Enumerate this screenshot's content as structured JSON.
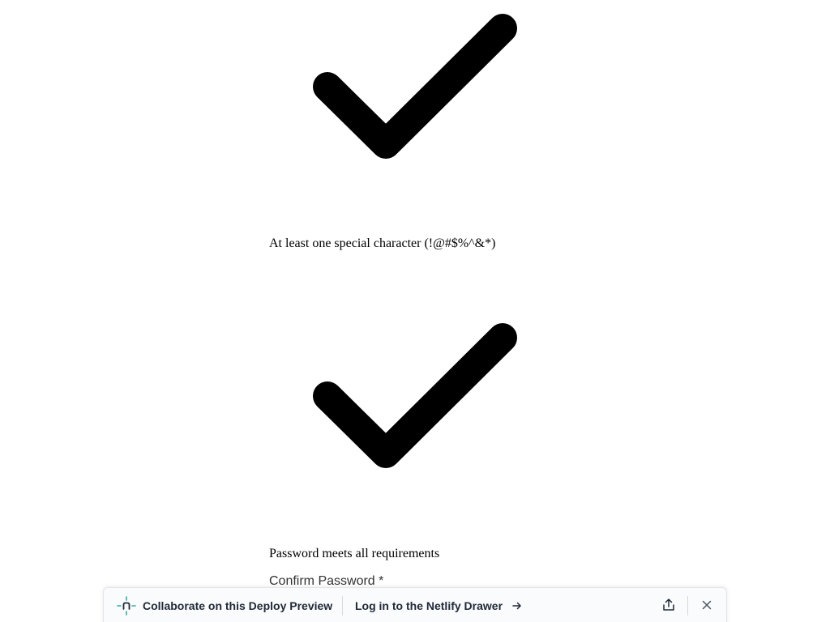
{
  "requirements": [
    {
      "icon": "checkmark-icon",
      "label": "At least one special character (!@#$%^&*)"
    },
    {
      "icon": "checkmark-icon",
      "label": "Password meets all requirements"
    }
  ],
  "form": {
    "confirm_password_label": "Confirm Password *"
  },
  "drawer": {
    "logo_icon": "netlify-logo-icon",
    "collaborate_text": "Collaborate on this Deploy Preview",
    "login_text": "Log in to the Netlify Drawer",
    "login_icon": "arrow-right-icon",
    "share_icon": "share-icon",
    "close_icon": "close-icon",
    "accent_color": "#32a9a3"
  }
}
